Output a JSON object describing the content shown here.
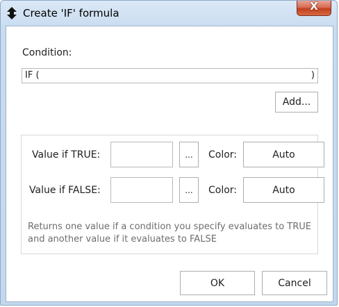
{
  "window": {
    "title": "Create 'IF' formula",
    "close_glyph": "X",
    "icon": "dialog-app-icon"
  },
  "condition": {
    "label": "Condition:",
    "prefix": "IF (",
    "value": "",
    "suffix": ")"
  },
  "add_button": "Add...",
  "true_row": {
    "label": "Value if TRUE:",
    "value": "",
    "browse": "...",
    "color_label": "Color:",
    "color_value": "Auto"
  },
  "false_row": {
    "label": "Value if FALSE:",
    "value": "",
    "browse": "...",
    "color_label": "Color:",
    "color_value": "Auto"
  },
  "description": "Returns one value if a condition you specify evaluates to TRUE and another value if it evaluates to FALSE",
  "footer": {
    "ok": "OK",
    "cancel": "Cancel"
  },
  "colors": {
    "title_bar": "#c8dcf0",
    "close_button": "#c2401f",
    "hint_text": "#6d6d6d"
  }
}
